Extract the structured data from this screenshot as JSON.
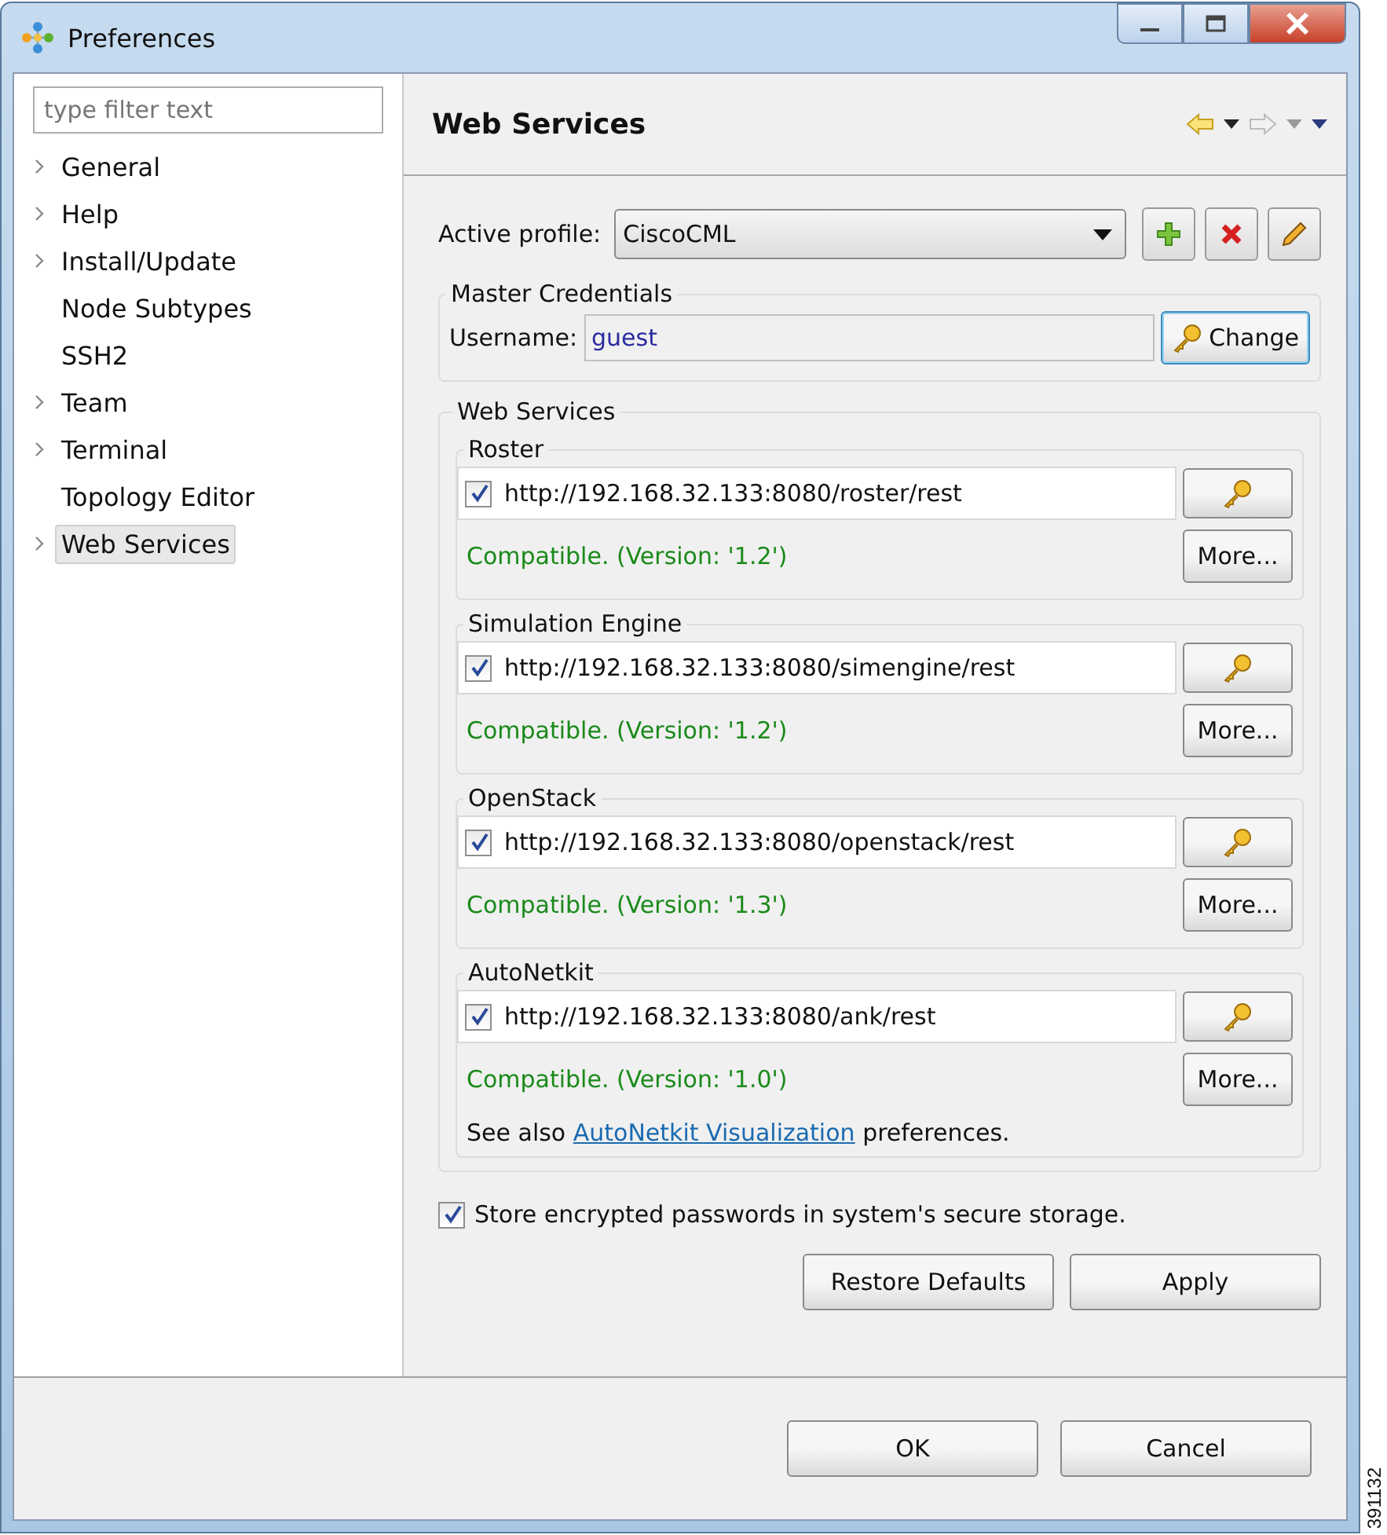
{
  "window": {
    "title": "Preferences"
  },
  "sidebar": {
    "filter": {
      "placeholder": "type filter text"
    },
    "items": [
      {
        "label": "General",
        "expandable": true,
        "selected": false
      },
      {
        "label": "Help",
        "expandable": true,
        "selected": false
      },
      {
        "label": "Install/Update",
        "expandable": true,
        "selected": false
      },
      {
        "label": "Node Subtypes",
        "expandable": false,
        "selected": false
      },
      {
        "label": "SSH2",
        "expandable": false,
        "selected": false
      },
      {
        "label": "Team",
        "expandable": true,
        "selected": false
      },
      {
        "label": "Terminal",
        "expandable": true,
        "selected": false
      },
      {
        "label": "Topology Editor",
        "expandable": false,
        "selected": false
      },
      {
        "label": "Web Services",
        "expandable": true,
        "selected": true
      }
    ]
  },
  "page": {
    "title": "Web Services",
    "active_profile": {
      "label": "Active profile:",
      "value": "CiscoCML"
    },
    "master_credentials": {
      "title": "Master Credentials",
      "username_label": "Username:",
      "username": "guest",
      "change_button": "Change"
    },
    "web_services": {
      "title": "Web Services",
      "services": [
        {
          "name": "Roster",
          "enabled": true,
          "url": "http://192.168.32.133:8080/roster/rest",
          "status": "Compatible.  (Version: '1.2')",
          "more_button": "More..."
        },
        {
          "name": "Simulation Engine",
          "enabled": true,
          "url": "http://192.168.32.133:8080/simengine/rest",
          "status": "Compatible.  (Version: '1.2')",
          "more_button": "More..."
        },
        {
          "name": "OpenStack",
          "enabled": true,
          "url": "http://192.168.32.133:8080/openstack/rest",
          "status": "Compatible.  (Version: '1.3')",
          "more_button": "More..."
        },
        {
          "name": "AutoNetkit",
          "enabled": true,
          "url": "http://192.168.32.133:8080/ank/rest",
          "status": "Compatible.  (Version: '1.0')",
          "more_button": "More..."
        }
      ],
      "see_also": {
        "before": "See also",
        "link": "AutoNetkit Visualization",
        "after": "preferences."
      }
    },
    "store_passwords": {
      "label": "Store encrypted passwords in system's secure storage.",
      "checked": true
    },
    "restore_defaults_button": "Restore Defaults",
    "apply_button": "Apply"
  },
  "dialog_buttons": [
    "OK",
    "Cancel"
  ],
  "figure_number": "391132"
}
